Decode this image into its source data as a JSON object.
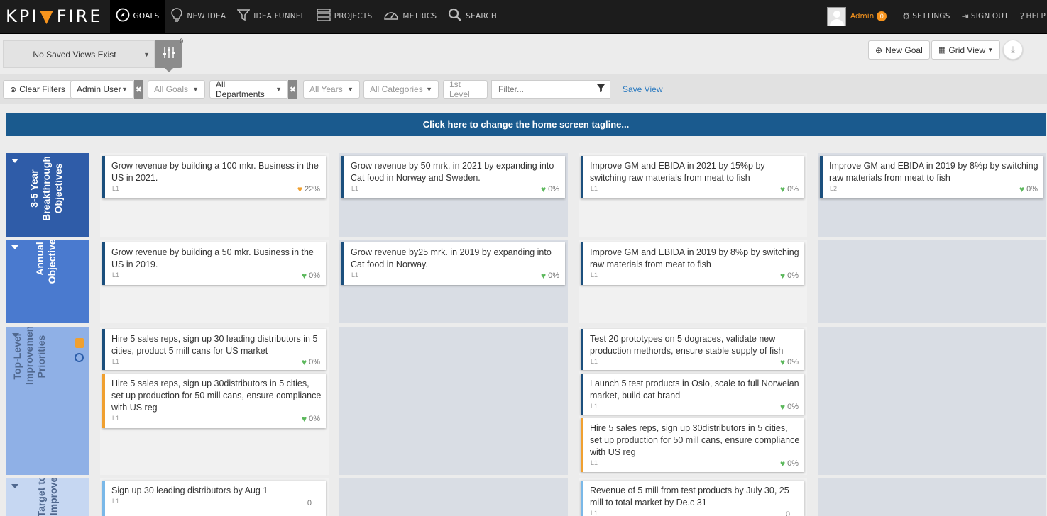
{
  "brand": {
    "logo_left": "KPI",
    "logo_mark": "▼",
    "logo_right": "FIRE"
  },
  "nav": {
    "items": [
      {
        "icon": "compass-icon",
        "label": "GOALS"
      },
      {
        "icon": "lightbulb-icon",
        "label": "NEW IDEA"
      },
      {
        "icon": "funnel-icon",
        "label": "IDEA FUNNEL"
      },
      {
        "icon": "list-icon",
        "label": "PROJECTS"
      },
      {
        "icon": "gauge-icon",
        "label": "METRICS"
      },
      {
        "icon": "search-icon",
        "label": "SEARCH"
      }
    ],
    "user": "Admin",
    "user_badge": "0",
    "settings": "SETTINGS",
    "signout": "SIGN OUT",
    "help": "HELP"
  },
  "toolbar": {
    "saved_views": "No Saved Views Exist",
    "filter_count": "0",
    "new_goal": "New Goal",
    "grid_view": "Grid View"
  },
  "filters": {
    "clear": "Clear Filters",
    "user": "Admin User",
    "goals": "All Goals",
    "departments": "All Departments",
    "years": "All Years",
    "categories": "All Categories",
    "level": "1st Level",
    "filter_placeholder": "Filter...",
    "save_view": "Save View"
  },
  "tagline": "Click here to change the home screen tagline...",
  "colors": {
    "heart_green": "#5cb85c",
    "heart_orange": "#f0a030",
    "row1": "#2f5ca8",
    "row2": "#4a7acf",
    "row3": "#8fb0e6",
    "row4": "#c6d7f2",
    "accent": "#f7941d"
  },
  "rows": [
    {
      "label1": "3-5 Year",
      "label2": "Breakthrough",
      "label3": "Objectives"
    },
    {
      "label1": "Annual",
      "label2": "Objectives"
    },
    {
      "label1": "Top-Level",
      "label2": "Improvement",
      "label3": "Priorities"
    },
    {
      "label1": "Target to",
      "label2": "Improve"
    }
  ],
  "cards": {
    "r1c1": {
      "title": "Grow revenue by building a 100 mkr. Business in the US in 2021.",
      "level": "L1",
      "pct": "22%"
    },
    "r1c2": {
      "title": "Grow revenue by 50 mrk. in 2021 by expanding into Cat food in Norway and Sweden.",
      "level": "L1",
      "pct": "0%"
    },
    "r1c3": {
      "title": "Improve GM and EBIDA in 2021 by 15%p by switching raw materials from meat to fish",
      "level": "L1",
      "pct": "0%"
    },
    "r1c4": {
      "title": "Improve GM and EBIDA in 2019 by 8%p by switching raw materials from meat to fish",
      "level": "L2",
      "pct": "0%"
    },
    "r2c1": {
      "title": "Grow revenue by building a 50 mkr. Business in the US in 2019.",
      "level": "L1",
      "pct": "0%"
    },
    "r2c2": {
      "title": "Grow revenue by25 mrk. in 2019 by expanding into Cat food in Norway.",
      "level": "L1",
      "pct": "0%"
    },
    "r2c3": {
      "title": "Improve GM and EBIDA in 2019 by 8%p by switching raw materials from meat to fish",
      "level": "L1",
      "pct": "0%"
    },
    "r3c1a": {
      "title": "Hire 5 sales reps, sign up 30 leading distributors in 5 cities, product 5 mill cans for US market",
      "level": "L1",
      "pct": "0%"
    },
    "r3c1b": {
      "title": "Hire 5 sales reps, sign up 30distributors in 5 cities, set up production for 50 mill cans, ensure compliance with US reg",
      "level": "L1",
      "pct": "0%"
    },
    "r3c3a": {
      "title": "Test 20 prototypes on 5 dograces, validate new production methords, ensure stable supply of fish",
      "level": "L1",
      "pct": "0%"
    },
    "r3c3b": {
      "title": "Launch 5 test products in Oslo, scale to full Norweian market, build cat brand",
      "level": "L1",
      "pct": "0%"
    },
    "r3c3c": {
      "title": "Hire 5 sales reps, sign up 30distributors in 5 cities, set up production for 50 mill cans, ensure compliance with US reg",
      "level": "L1",
      "pct": "0%"
    },
    "r4c1": {
      "title": "Sign up 30 leading distributors by Aug 1",
      "level": "L1",
      "value": "0"
    },
    "r4c3": {
      "title": "Revenue of 5 mill from test products by July 30, 25 mill to total market by De.c 31",
      "level": "L1",
      "value": "0"
    }
  }
}
